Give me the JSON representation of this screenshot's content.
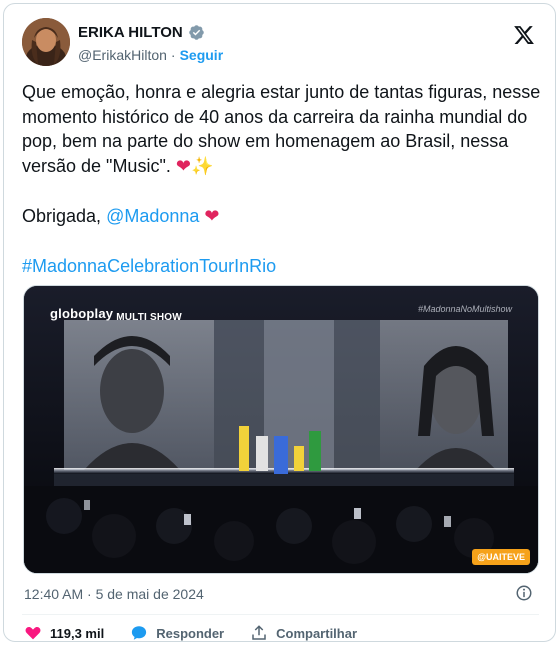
{
  "author": {
    "display_name": "ERIKA HILTON",
    "handle": "@ErikakHilton",
    "separator": "·",
    "follow_label": "Seguir"
  },
  "tweet": {
    "paragraph1": "Que emoção, honra e alegria estar junto de tantas figuras, nesse momento histórico de 40 anos da carreira da rainha mundial do pop, bem na parte do show em homenagem ao Brasil, nessa versão de \"Music\". ",
    "emoji_heart": "❤",
    "emoji_sparkles": "✨",
    "paragraph2_prefix": "Obrigada, ",
    "mention": "@Madonna",
    "hashtag": "#MadonnaCelebrationTourInRio"
  },
  "media": {
    "watermark_left": "globoplay",
    "watermark_left_brand": "MULTI SHOW",
    "watermark_right": "#MadonnaNoMultishow",
    "badge": "@UAITEVE"
  },
  "meta": {
    "timestamp": "12:40 AM · 5 de mai de 2024"
  },
  "actions": {
    "likes": "119,3 mil",
    "reply_label": "Responder",
    "share_label": "Compartilhar"
  },
  "colors": {
    "accent": "#1d9bf0",
    "like": "#f91880",
    "text": "#0f1419",
    "secondary": "#536471"
  }
}
